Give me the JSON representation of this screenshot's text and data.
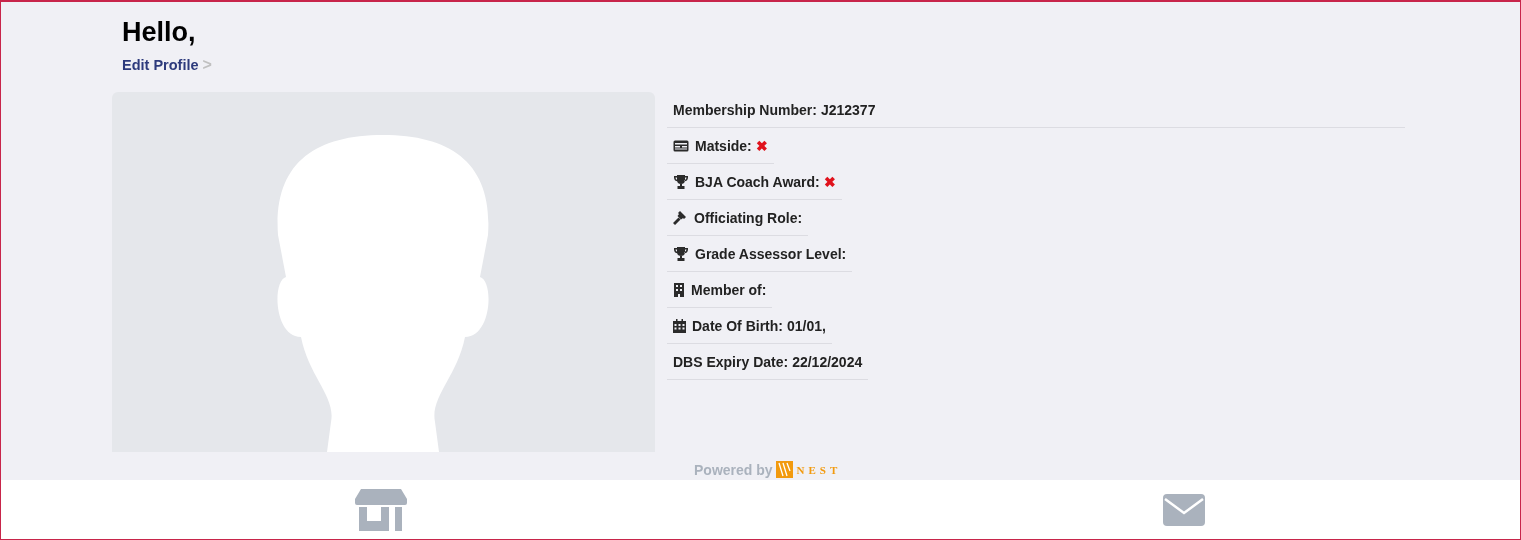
{
  "greeting": "Hello,",
  "edit_profile": {
    "label": "Edit Profile",
    "arrow": ">"
  },
  "details": [
    {
      "kind": "none",
      "label": "Membership Number:",
      "value": {
        "kind": "text",
        "text": "J212377"
      }
    },
    {
      "kind": "card",
      "label": "Matside:",
      "value": {
        "kind": "cross",
        "text": "✖"
      }
    },
    {
      "kind": "trophy",
      "label": "BJA Coach Award:",
      "value": {
        "kind": "cross",
        "text": "✖"
      }
    },
    {
      "kind": "gavel",
      "label": "Officiating Role:"
    },
    {
      "kind": "trophy",
      "label": "Grade Assessor Level:"
    },
    {
      "kind": "building",
      "label": "Member of:"
    },
    {
      "kind": "calendar",
      "label": "Date Of Birth:",
      "value": {
        "kind": "text",
        "text": "01/01,"
      }
    },
    {
      "kind": "none",
      "label": "DBS Expiry Date:",
      "value": {
        "kind": "text",
        "text": "22/12/2024"
      }
    }
  ],
  "footer": {
    "powered_by": "Powered by",
    "brand": "NEST"
  },
  "nav": [
    {
      "kind": "store"
    },
    {
      "kind": "mail"
    }
  ]
}
